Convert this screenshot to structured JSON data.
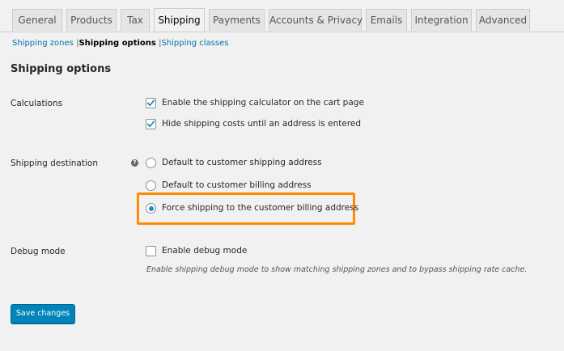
{
  "tabs": [
    {
      "label": "General",
      "active": false
    },
    {
      "label": "Products",
      "active": false
    },
    {
      "label": "Tax",
      "active": false
    },
    {
      "label": "Shipping",
      "active": true
    },
    {
      "label": "Payments",
      "active": false
    },
    {
      "label": "Accounts & Privacy",
      "active": false
    },
    {
      "label": "Emails",
      "active": false
    },
    {
      "label": "Integration",
      "active": false
    },
    {
      "label": "Advanced",
      "active": false
    }
  ],
  "subnav": {
    "zones": "Shipping zones",
    "options": "Shipping options",
    "classes": "Shipping classes",
    "separator": "|"
  },
  "section_title": "Shipping options",
  "calculations": {
    "label": "Calculations",
    "options": [
      {
        "label": "Enable the shipping calculator on the cart page",
        "checked": true
      },
      {
        "label": "Hide shipping costs until an address is entered",
        "checked": true
      }
    ]
  },
  "destination": {
    "label": "Shipping destination",
    "help_icon": "?",
    "options": [
      {
        "label": "Default to customer shipping address",
        "selected": false
      },
      {
        "label": "Default to customer billing address",
        "selected": false
      },
      {
        "label": "Force shipping to the customer billing address",
        "selected": true
      }
    ]
  },
  "debug": {
    "label": "Debug mode",
    "option": {
      "label": "Enable debug mode",
      "checked": false
    },
    "description": "Enable shipping debug mode to show matching shipping zones and to bypass shipping rate cache."
  },
  "save_button": "Save changes",
  "colors": {
    "accent": "#0085ba",
    "link": "#0073aa",
    "highlight": "#ff8c00",
    "radio_dot": "#1e8cbe"
  }
}
